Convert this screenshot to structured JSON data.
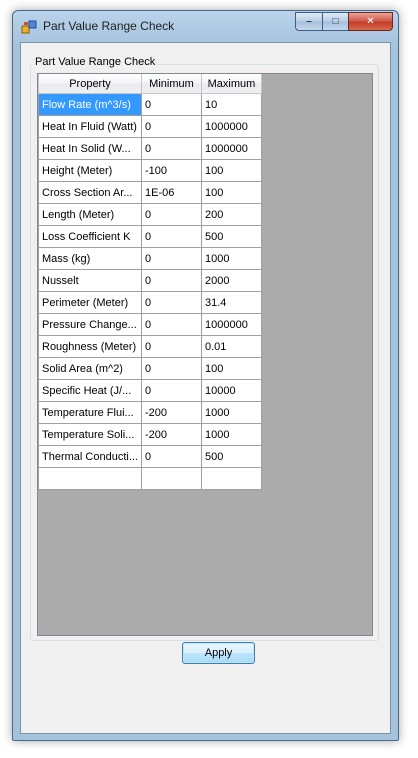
{
  "window": {
    "title": "Part Value Range Check",
    "icon": "app-icon",
    "controls": {
      "minimize": "–",
      "maximize": "□",
      "close": "✕"
    }
  },
  "group": {
    "legend": "Part Value Range Check"
  },
  "grid": {
    "columns": [
      "Property",
      "Minimum",
      "Maximum"
    ],
    "rows": [
      {
        "property": "Flow Rate (m^3/s)",
        "min": "0",
        "max": "10"
      },
      {
        "property": "Heat In Fluid (Watt)",
        "min": "0",
        "max": "1000000"
      },
      {
        "property": "Heat In Solid (W...",
        "min": "0",
        "max": "1000000"
      },
      {
        "property": "Height (Meter)",
        "min": "-100",
        "max": "100"
      },
      {
        "property": "Cross Section Ar...",
        "min": "1E-06",
        "max": "100"
      },
      {
        "property": "Length (Meter)",
        "min": "0",
        "max": "200"
      },
      {
        "property": "Loss Coefficient K",
        "min": "0",
        "max": "500"
      },
      {
        "property": "Mass (kg)",
        "min": "0",
        "max": "1000"
      },
      {
        "property": "Nusselt",
        "min": "0",
        "max": "2000"
      },
      {
        "property": "Perimeter (Meter)",
        "min": "0",
        "max": "31.4"
      },
      {
        "property": "Pressure Change...",
        "min": "0",
        "max": "1000000"
      },
      {
        "property": "Roughness (Meter)",
        "min": "0",
        "max": "0.01"
      },
      {
        "property": "Solid Area (m^2)",
        "min": "0",
        "max": "100"
      },
      {
        "property": "Specific Heat (J/...",
        "min": "0",
        "max": "10000"
      },
      {
        "property": "Temperature Flui...",
        "min": "-200",
        "max": "1000"
      },
      {
        "property": "Temperature Soli...",
        "min": "-200",
        "max": "1000"
      },
      {
        "property": "Thermal Conducti...",
        "min": "0",
        "max": "500"
      },
      {
        "property": "",
        "min": "",
        "max": ""
      }
    ]
  },
  "buttons": {
    "apply": "Apply"
  },
  "colors": {
    "selection": "#3399ff",
    "grid_background": "#ababab",
    "client": "#f0f0f0"
  }
}
